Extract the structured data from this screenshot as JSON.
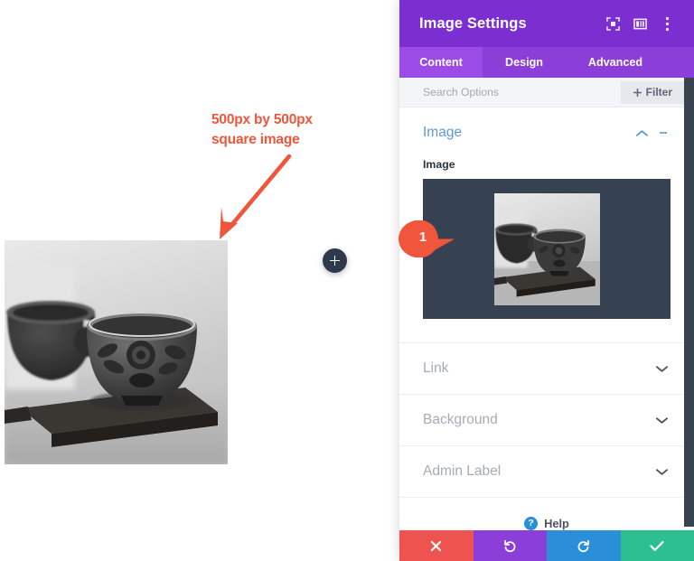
{
  "canvas": {
    "annotation": {
      "line1": "500px by 500px",
      "line2": "square image",
      "color": "#f0563c",
      "arrow_icon": "down-left-arrow-icon"
    },
    "photo": {
      "alt": "black and white photo of two tea cups on a wooden shelf",
      "add_button_icon": "plus-icon"
    }
  },
  "callout": {
    "number": "1",
    "color": "#f0563c"
  },
  "panel": {
    "header": {
      "title": "Image Settings",
      "bg": "#7b2fd0",
      "icons": [
        {
          "name": "focus-expand-icon"
        },
        {
          "name": "split-layout-icon"
        },
        {
          "name": "kebab-menu-icon"
        }
      ]
    },
    "tabs": [
      {
        "label": "Content",
        "active": true
      },
      {
        "label": "Design",
        "active": false
      },
      {
        "label": "Advanced",
        "active": false
      }
    ],
    "search": {
      "placeholder": "Search Options",
      "value": "",
      "filter_label": "Filter",
      "filter_icon": "plus-icon"
    },
    "sections": [
      {
        "title": "Image",
        "state": "open",
        "toggle_icon": "chevron-up-icon",
        "menu_icon": "kebab-menu-icon",
        "field_label": "Image",
        "upload_bg": "#364151"
      },
      {
        "title": "Link",
        "state": "closed",
        "toggle_icon": "chevron-down-icon"
      },
      {
        "title": "Background",
        "state": "closed",
        "toggle_icon": "chevron-down-icon"
      },
      {
        "title": "Admin Label",
        "state": "closed",
        "toggle_icon": "chevron-down-icon"
      }
    ],
    "help": {
      "label": "Help",
      "icon": "question-mark-icon"
    },
    "footer_actions": [
      {
        "name": "cancel-button",
        "icon": "close-x-icon",
        "color": "#ef5350"
      },
      {
        "name": "undo-button",
        "icon": "undo-arrow-icon",
        "color": "#8b3ed8"
      },
      {
        "name": "redo-button",
        "icon": "redo-arrow-icon",
        "color": "#2a8fd8"
      },
      {
        "name": "save-button",
        "icon": "check-icon",
        "color": "#2ebf91"
      }
    ]
  }
}
